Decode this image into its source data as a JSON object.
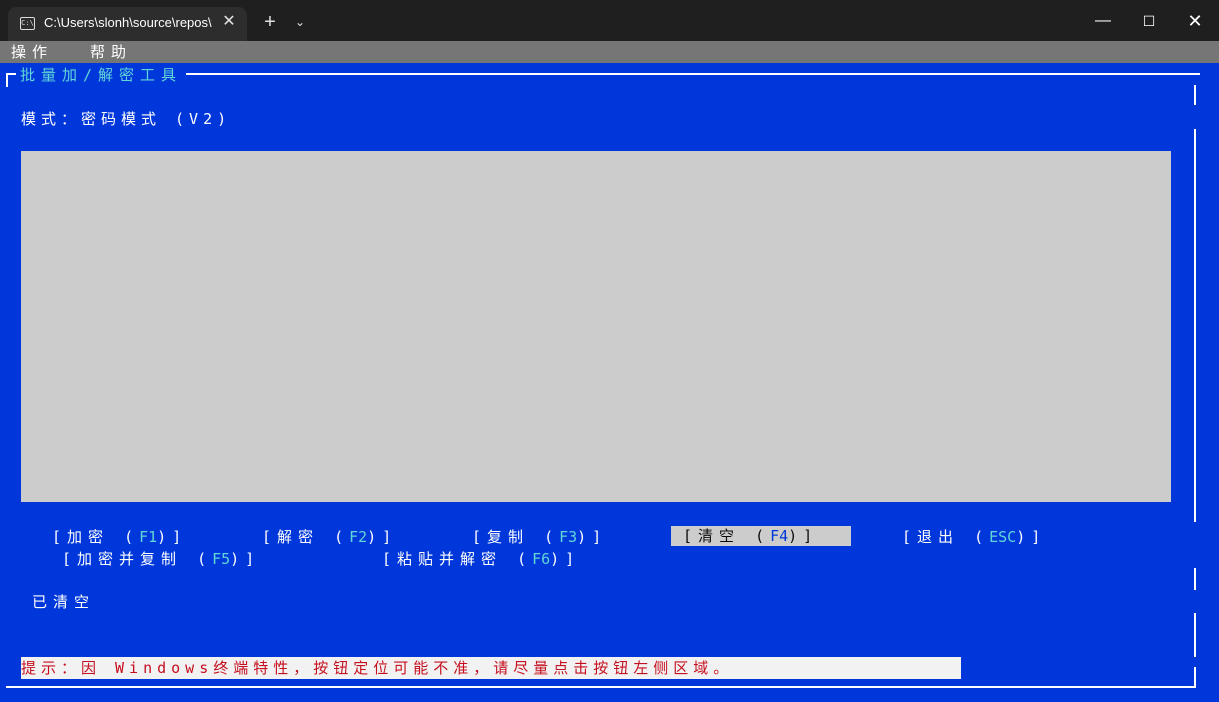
{
  "window": {
    "tab_title": "C:\\Users\\slonh\\source\\repos\\t",
    "tab_icon_glyph": "C:\\",
    "close_tab_glyph": "✕",
    "new_tab_glyph": "+",
    "dropdown_glyph": "⌄",
    "minimize_glyph": "—",
    "maximize_glyph": "☐",
    "close_glyph": "✕"
  },
  "menu": {
    "items": [
      {
        "label": "操作"
      },
      {
        "label": "帮助"
      }
    ]
  },
  "app": {
    "title": "批量加/解密工具",
    "mode_label": "模式：密码模式 (V2)",
    "status": "已清空",
    "hint": "提示：因 Windows终端特性，按钮定位可能不准，请尽量点击按钮左侧区域。"
  },
  "buttons": {
    "encrypt": {
      "label": "[加密 ",
      "key": "F1",
      "close": ")]",
      "open": "("
    },
    "decrypt": {
      "label": "[解密 ",
      "key": "F2",
      "close": ")]",
      "open": "("
    },
    "copy": {
      "label": "[复制 ",
      "key": "F3",
      "close": ")]",
      "open": "("
    },
    "clear": {
      "label": "[清空 ",
      "key": "F4",
      "close": ")]",
      "open": "("
    },
    "exit": {
      "label": "[退出 ",
      "key": "ESC",
      "close": ")]",
      "open": "("
    },
    "encrypt_copy": {
      "label": "[加密并复制 ",
      "key": "F5",
      "close": ")]",
      "open": "("
    },
    "paste_decrypt": {
      "label": "[粘贴并解密 ",
      "key": "F6",
      "close": ")]",
      "open": "("
    }
  },
  "colors": {
    "terminal_bg": "#0037da",
    "menu_bg": "#767676",
    "text_area_bg": "#cccccc",
    "accent_cyan": "#61d6d6",
    "hint_red": "#c50f1f"
  }
}
